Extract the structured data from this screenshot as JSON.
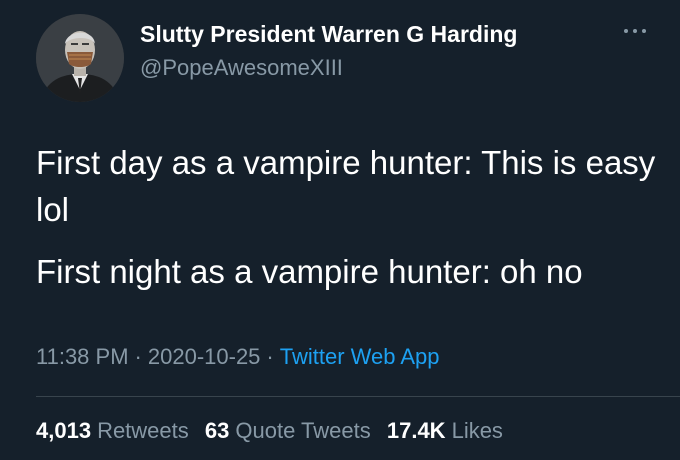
{
  "user": {
    "display_name": "Slutty President Warren G Harding",
    "handle": "@PopeAwesomeXIII",
    "avatar_icon": "portrait-with-mask-avatar"
  },
  "tweet": {
    "paragraphs": [
      "First day as a vampire hunter: This is easy lol",
      "First night as a vampire hunter: oh no"
    ],
    "time": "11:38 PM",
    "date": "2020-10-25",
    "source": "Twitter Web App",
    "separator": "·"
  },
  "stats": {
    "retweets_count": "4,013",
    "retweets_label": "Retweets",
    "quotes_count": "63",
    "quotes_label": "Quote Tweets",
    "likes_count": "17.4K",
    "likes_label": "Likes"
  },
  "menu": {
    "icon": "more-options-icon"
  },
  "colors": {
    "background": "#15202b",
    "primary_text": "#ffffff",
    "secondary_text": "#8899a6",
    "link": "#1da1f2",
    "divider": "#38444d"
  }
}
